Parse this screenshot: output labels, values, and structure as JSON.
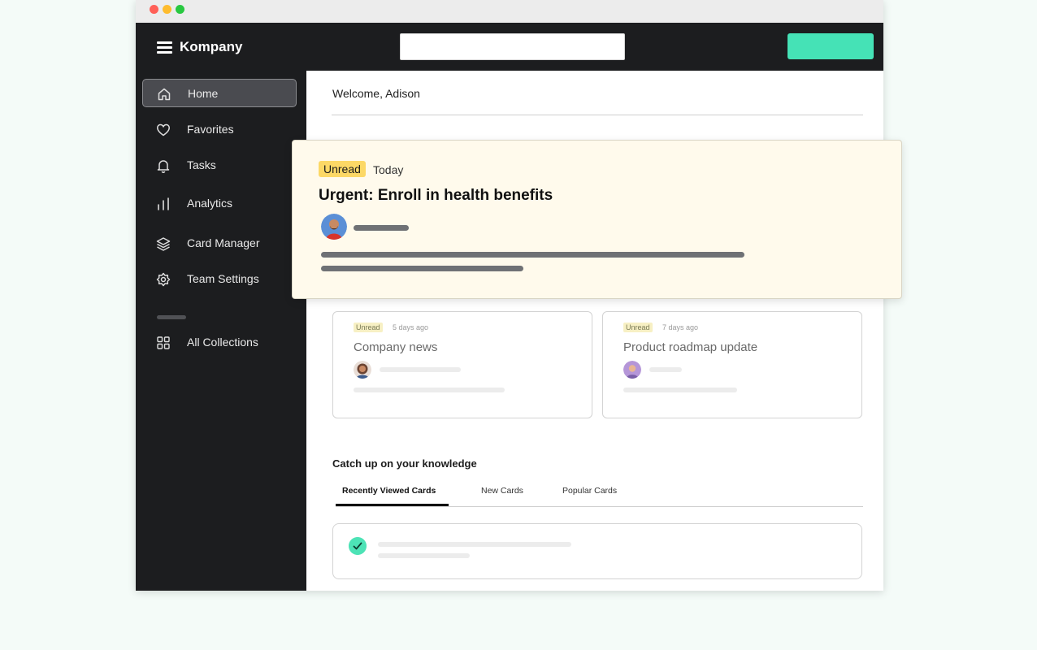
{
  "app": {
    "brand": "Kompany"
  },
  "header": {
    "search_placeholder": ""
  },
  "sidebar": {
    "items": [
      {
        "label": "Home",
        "icon": "home-icon",
        "active": true
      },
      {
        "label": "Favorites",
        "icon": "heart-icon"
      },
      {
        "label": "Tasks",
        "icon": "bell-icon"
      },
      {
        "label": "Analytics",
        "icon": "bar-chart-icon"
      },
      {
        "label": "Card Manager",
        "icon": "layers-icon"
      },
      {
        "label": "Team Settings",
        "icon": "gear-icon"
      },
      {
        "label": "All Collections",
        "icon": "grid-icon"
      }
    ]
  },
  "main": {
    "welcome": "Welcome, Adison",
    "notification": {
      "badge": "Unread",
      "time": "Today",
      "title": "Urgent: Enroll in health benefits"
    },
    "cards": [
      {
        "badge": "Unread",
        "time": "5 days ago",
        "title": "Company news"
      },
      {
        "badge": "Unread",
        "time": "7 days ago",
        "title": "Product roadmap update"
      }
    ],
    "knowledge": {
      "title": "Catch up on your knowledge",
      "tabs": [
        "Recently Viewed Cards",
        "New Cards",
        "Popular Cards"
      ],
      "active_tab": "Recently Viewed Cards"
    }
  },
  "colors": {
    "accent": "#45e2b6",
    "sidebar": "#1c1d1f",
    "unread_badge": "#fcd866",
    "notification_bg": "#fffaec"
  }
}
